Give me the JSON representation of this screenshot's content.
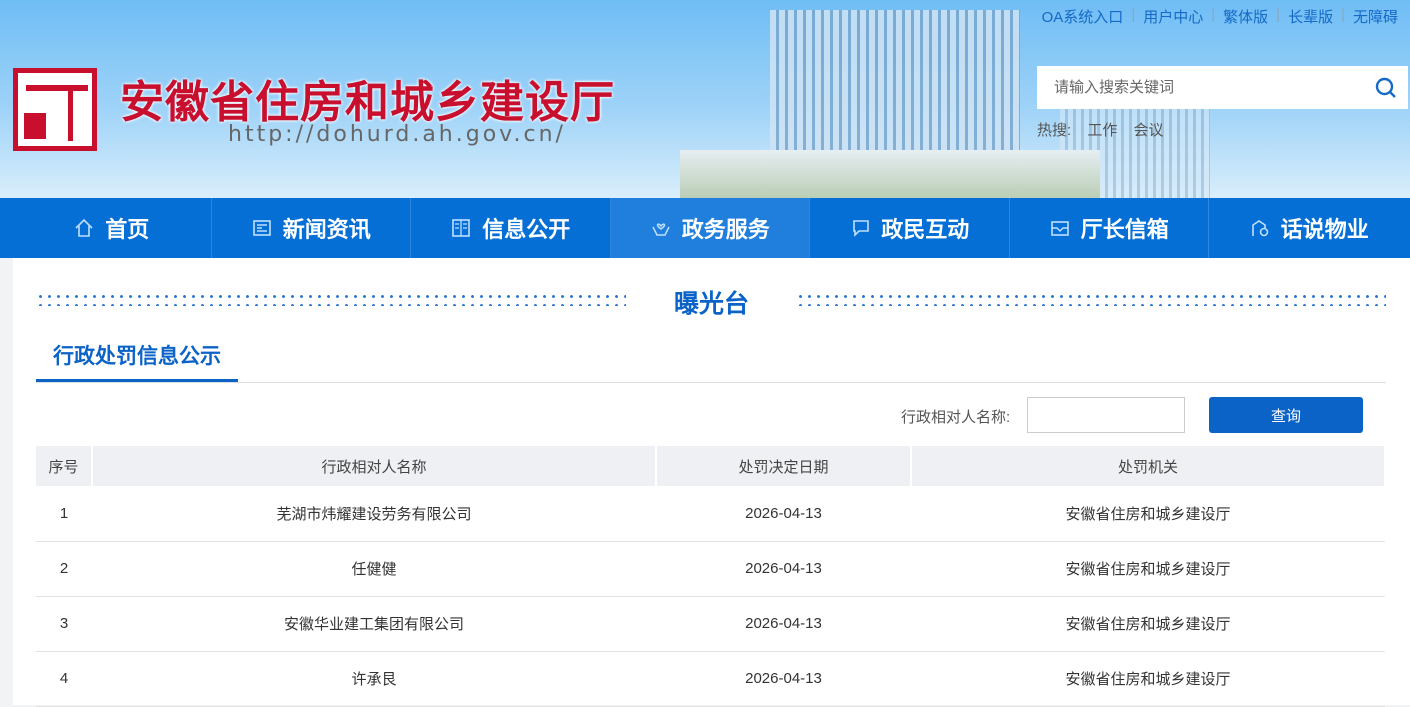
{
  "header": {
    "site_title": "安徽省住房和城乡建设厅",
    "site_url": "http://dohurd.ah.gov.cn/",
    "top_links": [
      "OA系统入口",
      "用户中心",
      "繁体版",
      "长辈版",
      "无障碍"
    ],
    "search_placeholder": "请输入搜索关键词",
    "hot_label": "热搜:",
    "hot_words": [
      "工作",
      "会议"
    ]
  },
  "nav": [
    {
      "label": "首页",
      "icon": "home-icon"
    },
    {
      "label": "新闻资讯",
      "icon": "news-icon"
    },
    {
      "label": "信息公开",
      "icon": "book-icon"
    },
    {
      "label": "政务服务",
      "icon": "heart-hands-icon",
      "active": true
    },
    {
      "label": "政民互动",
      "icon": "chat-icon"
    },
    {
      "label": "厅长信箱",
      "icon": "mail-icon"
    },
    {
      "label": "话说物业",
      "icon": "building-gear-icon"
    }
  ],
  "section": {
    "title": "曝光台",
    "tab": "行政处罚信息公示",
    "filter_label": "行政相对人名称:",
    "filter_value": "",
    "query_label": "查询"
  },
  "table": {
    "headers": [
      "序号",
      "行政相对人名称",
      "处罚决定日期",
      "处罚机关"
    ],
    "rows": [
      [
        "1",
        "芜湖市炜耀建设劳务有限公司",
        "2026-04-13",
        "安徽省住房和城乡建设厅"
      ],
      [
        "2",
        "任健健",
        "2026-04-13",
        "安徽省住房和城乡建设厅"
      ],
      [
        "3",
        "安徽华业建工集团有限公司",
        "2026-04-13",
        "安徽省住房和城乡建设厅"
      ],
      [
        "4",
        "许承艮",
        "2026-04-13",
        "安徽省住房和城乡建设厅"
      ]
    ]
  },
  "colors": {
    "brand_red": "#c8102e",
    "nav_blue": "#056fd6",
    "accent": "#0b63c8"
  }
}
